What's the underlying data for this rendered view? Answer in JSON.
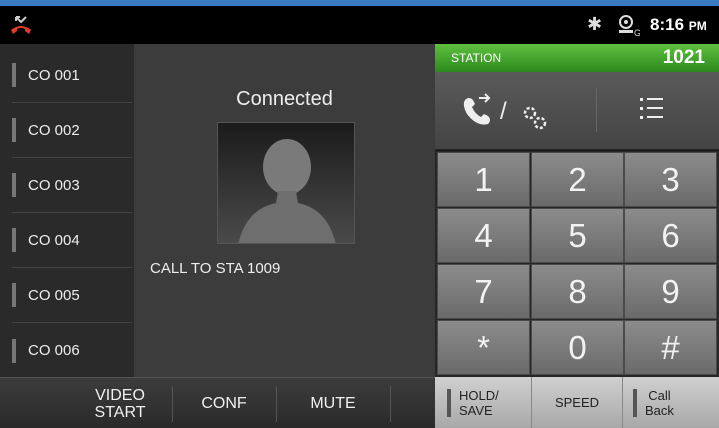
{
  "status_bar": {
    "time": "8:16",
    "ampm": "PM",
    "icons": [
      "missed-call-icon",
      "bluetooth-icon",
      "gps-icon"
    ]
  },
  "co_lines": [
    {
      "label": "CO 001"
    },
    {
      "label": "CO 002"
    },
    {
      "label": "CO 003"
    },
    {
      "label": "CO 004"
    },
    {
      "label": "CO 005"
    },
    {
      "label": "CO 006"
    }
  ],
  "call": {
    "status": "Connected",
    "target": "CALL TO STA 1009"
  },
  "station": {
    "label": "STATION",
    "number": "1021"
  },
  "tools": {
    "left_icons": [
      "call-forward-icon",
      "settings-icon"
    ],
    "left_separator": "/",
    "right_icon": "list-icon"
  },
  "keypad": {
    "keys": [
      "1",
      "2",
      "3",
      "4",
      "5",
      "6",
      "7",
      "8",
      "9",
      "*",
      "0",
      "#"
    ]
  },
  "bottom_bar": {
    "video_start_line1": "VIDEO",
    "video_start_line2": "START",
    "conf": "CONF",
    "mute": "MUTE"
  },
  "right_bottom": {
    "hold_save_line1": "HOLD/",
    "hold_save_line2": "SAVE",
    "speed": "SPEED",
    "call_back_line1": "Call",
    "call_back_line2": "Back"
  },
  "colors": {
    "station_green": "#3aa02a",
    "accent_blue": "#3a7cc0",
    "missed_call_red": "#e03a2a"
  }
}
